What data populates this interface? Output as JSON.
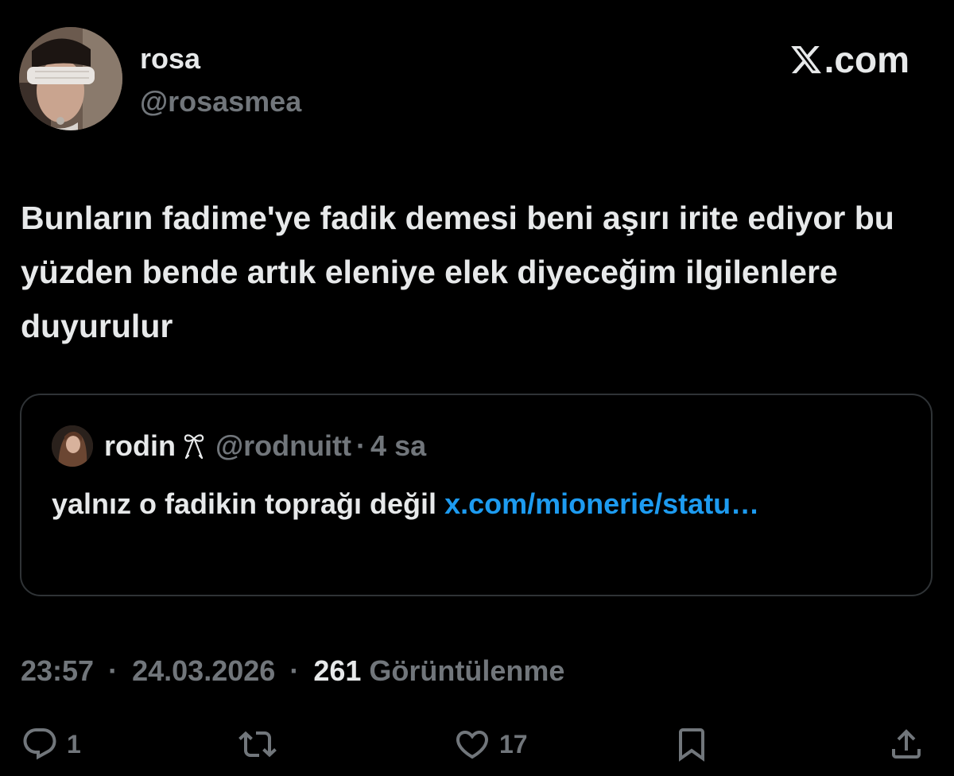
{
  "author": {
    "name": "rosa",
    "handle": "@rosasmea"
  },
  "brand": {
    "label": ".com",
    "icon": "x-logo-icon"
  },
  "tweet": {
    "text": "Bunların fadime'ye fadik demesi beni aşırı irite ediyor bu yüzden bende artık eleniye elek diyeceğim ilgilenlere duyurulur"
  },
  "quote": {
    "name": "rodin",
    "name_icon": "ribbon-bow-icon",
    "handle": "@rodnuitt",
    "dot": "·",
    "time": "4 sa",
    "text": "yalnız o fadikin toprağı değil ",
    "link": "x.com/mionerie/statu…",
    "link_color": "#1d9bf0"
  },
  "meta": {
    "time": "23:57",
    "sep1": "·",
    "date": "24.03.2026",
    "sep2": "·",
    "views_count": "261",
    "views_label": "Görüntülenme"
  },
  "actions": {
    "reply_count": "1",
    "like_count": "17"
  },
  "colors": {
    "background": "#000000",
    "primary_text": "#e7e9ea",
    "secondary_text": "#71767b",
    "border": "#2f3336",
    "link": "#1d9bf0"
  }
}
